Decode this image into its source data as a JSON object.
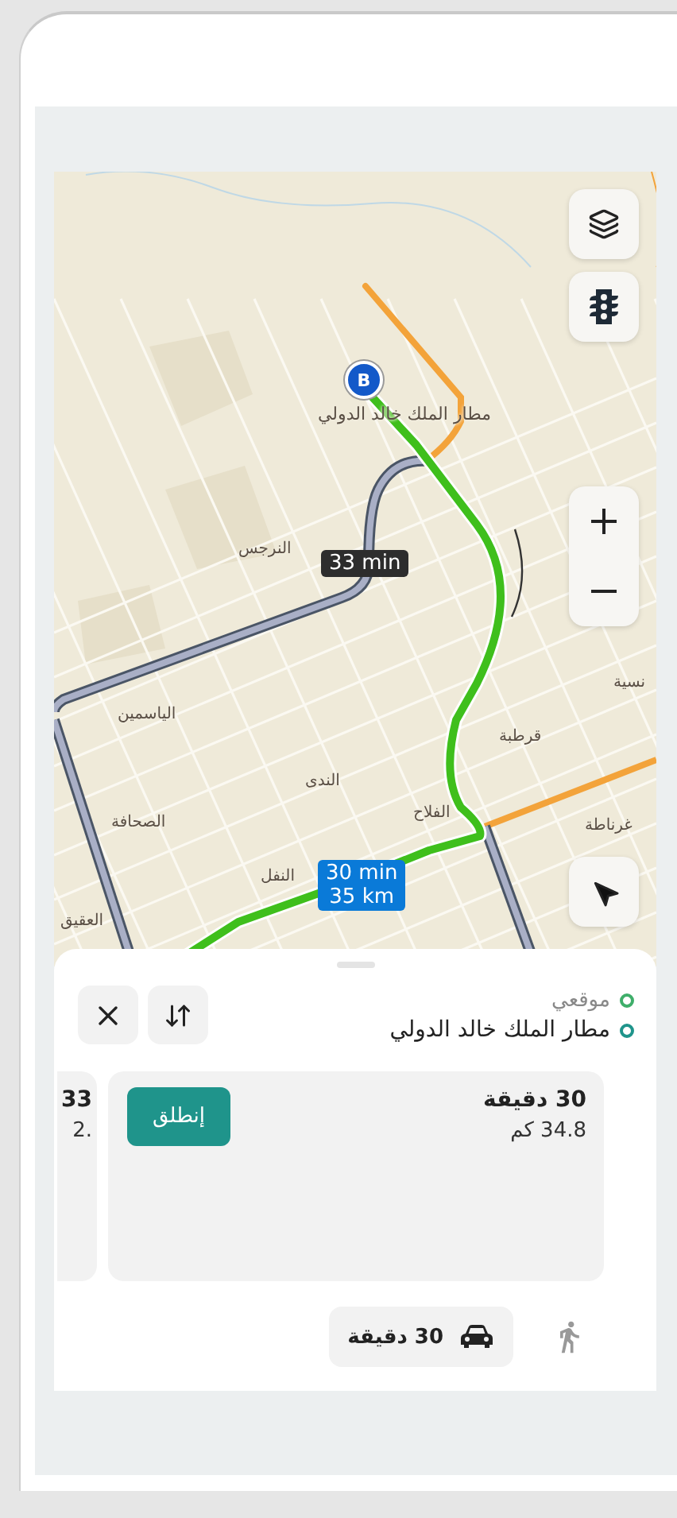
{
  "map": {
    "destination_marker": "B",
    "labels": [
      {
        "kind": "poi",
        "text": "مطار الملك خالد الدولي"
      },
      {
        "kind": "district",
        "text": "النرجس"
      },
      {
        "kind": "district",
        "text": "الياسمين"
      },
      {
        "kind": "district",
        "text": "الصحافة"
      },
      {
        "kind": "district",
        "text": "العقيق"
      },
      {
        "kind": "district",
        "text": "الندى"
      },
      {
        "kind": "district",
        "text": "النفل"
      },
      {
        "kind": "district",
        "text": "الفلاح"
      },
      {
        "kind": "district",
        "text": "قرطبة"
      },
      {
        "kind": "district",
        "text": "غرناطة"
      },
      {
        "kind": "district",
        "text": "نسية"
      }
    ],
    "routes": [
      {
        "kind": "alternate",
        "time": "33 min"
      },
      {
        "kind": "primary",
        "time": "30 min",
        "distance": "35 km"
      }
    ],
    "controls": [
      {
        "kind": "layers"
      },
      {
        "kind": "traffic"
      },
      {
        "kind": "zoom"
      },
      {
        "kind": "locate"
      }
    ]
  },
  "sheet": {
    "origin": "موقعي",
    "destination": "مطار الملك خالد الدولي",
    "actions": [
      {
        "kind": "swap"
      },
      {
        "kind": "close"
      }
    ],
    "route_options": [
      {
        "duration": "30 دقيقة",
        "distance": "34.8 كم",
        "action": "إنطلق"
      },
      {
        "duration": "33",
        "distance": ".2"
      }
    ],
    "travel_modes": [
      {
        "kind": "walk",
        "selected": false
      },
      {
        "kind": "car",
        "selected": true,
        "duration": "30 دقيقة"
      }
    ]
  }
}
